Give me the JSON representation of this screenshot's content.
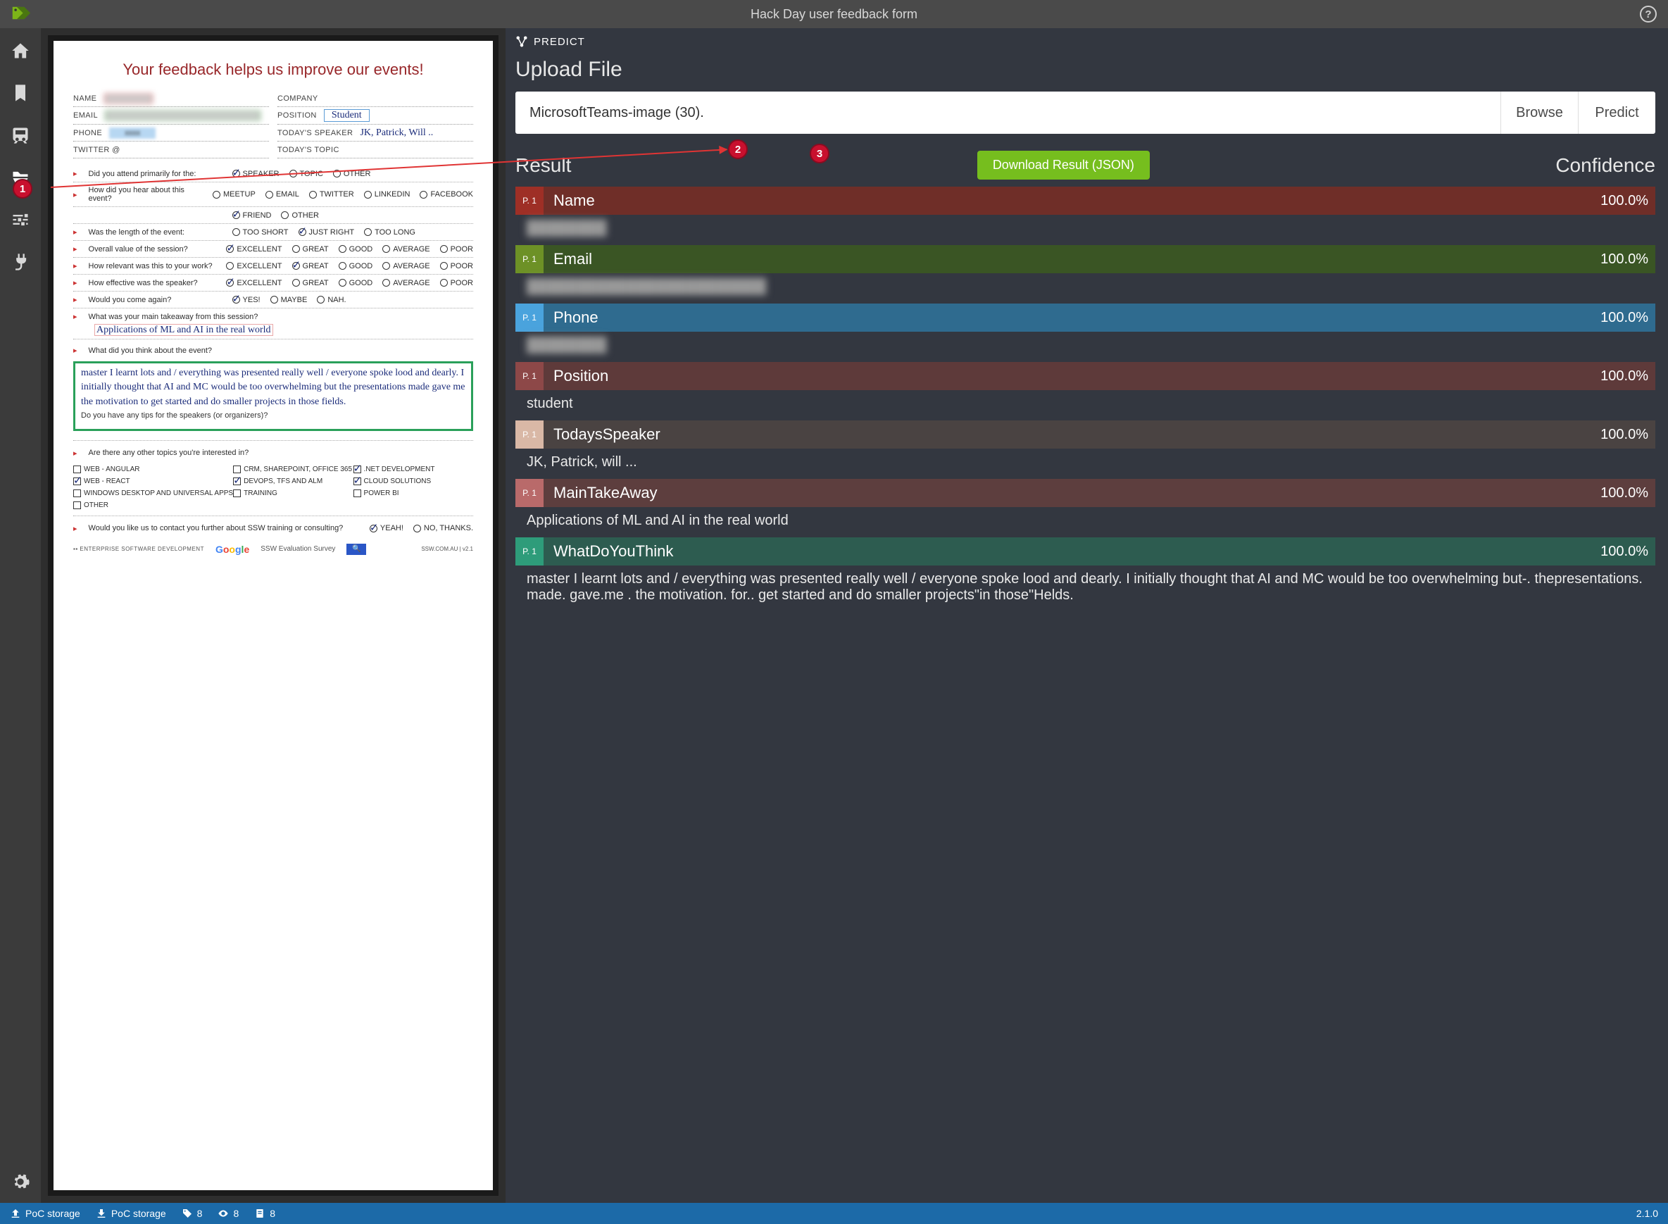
{
  "topbar": {
    "title": "Hack Day user feedback form"
  },
  "upload": {
    "panel_label": "PREDICT",
    "heading": "Upload File",
    "filename": "MicrosoftTeams-image (30).",
    "browse": "Browse",
    "predict": "Predict"
  },
  "resultHeader": {
    "title": "Result",
    "download": "Download Result (JSON)",
    "confidence": "Confidence"
  },
  "results": [
    {
      "cls": "c-name",
      "page": "P. 1",
      "field": "Name",
      "conf": "100.0%",
      "value": "████████",
      "blurred": true
    },
    {
      "cls": "c-email",
      "page": "P. 1",
      "field": "Email",
      "conf": "100.0%",
      "value": "████████████████████████",
      "blurred": true
    },
    {
      "cls": "c-phone",
      "page": "P. 1",
      "field": "Phone",
      "conf": "100.0%",
      "value": "████████",
      "blurred": true
    },
    {
      "cls": "c-position",
      "page": "P. 1",
      "field": "Position",
      "conf": "100.0%",
      "value": "student",
      "blurred": false
    },
    {
      "cls": "c-speaker",
      "page": "P. 1",
      "field": "TodaysSpeaker",
      "conf": "100.0%",
      "value": "JK, Patrick, will ...",
      "blurred": false
    },
    {
      "cls": "c-takeaway",
      "page": "P. 1",
      "field": "MainTakeAway",
      "conf": "100.0%",
      "value": "Applications of ML and AI in the real world",
      "blurred": false
    },
    {
      "cls": "c-think",
      "page": "P. 1",
      "field": "WhatDoYouThink",
      "conf": "100.0%",
      "value": "master I learnt lots and / everything was presented really well / everyone spoke lood and dearly. I initially thought that AI and MC would be too overwhelming but-. thepresentations. made. gave.me . the motivation. for.. get started and do smaller projects\"in those\"Helds.",
      "blurred": false
    }
  ],
  "doc": {
    "heading": "Your feedback helps us improve our events!",
    "labels": {
      "name": "NAME",
      "company": "COMPANY",
      "email": "EMAIL",
      "position": "POSITION",
      "phone": "PHONE",
      "speaker": "TODAY'S SPEAKER",
      "twitter": "TWITTER @",
      "topic": "TODAY'S TOPIC"
    },
    "handwritten": {
      "position": "Student",
      "speaker": "JK, Patrick, Will ..",
      "takeaway": "Applications of ML and AI in the real world",
      "think": "master I learnt lots and / everything was presented really well / everyone spoke lood and dearly. I initially thought that AI and MC would be too overwhelming but the presentations made gave me the motivation to get started and do smaller projects in those fields."
    },
    "questions": {
      "q1": "Did you attend primarily for the:",
      "q1o": [
        "SPEAKER",
        "TOPIC",
        "OTHER"
      ],
      "q2": "How did you hear about this event?",
      "q2o1": [
        "MEETUP",
        "EMAIL",
        "TWITTER",
        "LINKEDIN",
        "FACEBOOK"
      ],
      "q2o2": [
        "FRIEND",
        "OTHER"
      ],
      "q3": "Was the length of the event:",
      "q3o": [
        "TOO SHORT",
        "JUST RIGHT",
        "TOO LONG"
      ],
      "q4": "Overall value of the session?",
      "q5": "How relevant was this to your work?",
      "q6": "How effective was the speaker?",
      "qrating": [
        "EXCELLENT",
        "GREAT",
        "GOOD",
        "AVERAGE",
        "POOR"
      ],
      "q7": "Would you come again?",
      "q7o": [
        "YES!",
        "MAYBE",
        "NAH."
      ],
      "q8": "What was your main takeaway from this session?",
      "q9": "What did you think about the event?",
      "q9tips": "Do you have any tips for the speakers (or organizers)?",
      "q10": "Are there any other topics you're interested in?",
      "topics": [
        "WEB - ANGULAR",
        "CRM, SHAREPOINT, OFFICE 365",
        ".NET DEVELOPMENT",
        "WEB - REACT",
        "DEVOPS, TFS AND ALM",
        "CLOUD SOLUTIONS",
        "WINDOWS DESKTOP AND UNIVERSAL APPS",
        "TRAINING",
        "POWER BI",
        "OTHER",
        "",
        ""
      ],
      "q11": "Would you like us to contact you further about SSW training or consulting?",
      "q11o": [
        "YEAH!",
        "NO, THANKS."
      ],
      "footer_left": "ENTERPRISE SOFTWARE DEVELOPMENT",
      "footer_mid": "SSW Evaluation Survey",
      "footer_right": "SSW.COM.AU | v2.1"
    }
  },
  "status": {
    "storage1": "PoC storage",
    "storage2": "PoC storage",
    "tags": "8",
    "views": "8",
    "docs": "8",
    "version": "2.1.0"
  },
  "annotations": {
    "a1": "1",
    "a2": "2",
    "a3": "3"
  }
}
